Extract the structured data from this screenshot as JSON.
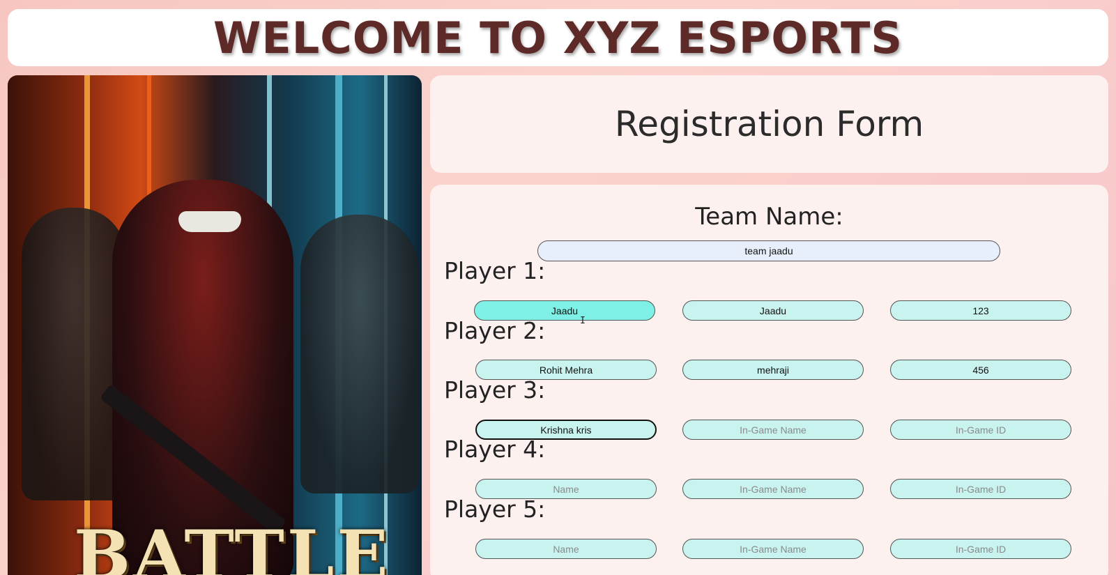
{
  "header": {
    "title": "WELCOME TO XYZ ESPORTS"
  },
  "poster": {
    "text": "BATTLE"
  },
  "form_title": "Registration Form",
  "team": {
    "label": "Team Name:",
    "value": "team jaadu"
  },
  "players": [
    {
      "label": "Player 1:",
      "name": "Jaadu",
      "ign": "Jaadu",
      "id": "123"
    },
    {
      "label": "Player 2:",
      "name": "Rohit Mehra",
      "ign": "mehraji",
      "id": "456"
    },
    {
      "label": "Player 3:",
      "name": "Krishna kris",
      "ign": "",
      "id": ""
    },
    {
      "label": "Player 4:",
      "name": "",
      "ign": "",
      "id": ""
    },
    {
      "label": "Player 5:",
      "name": "",
      "ign": "",
      "id": ""
    }
  ],
  "placeholders": {
    "name": "Name",
    "ign": "In-Game Name",
    "id": "In-Game ID"
  }
}
